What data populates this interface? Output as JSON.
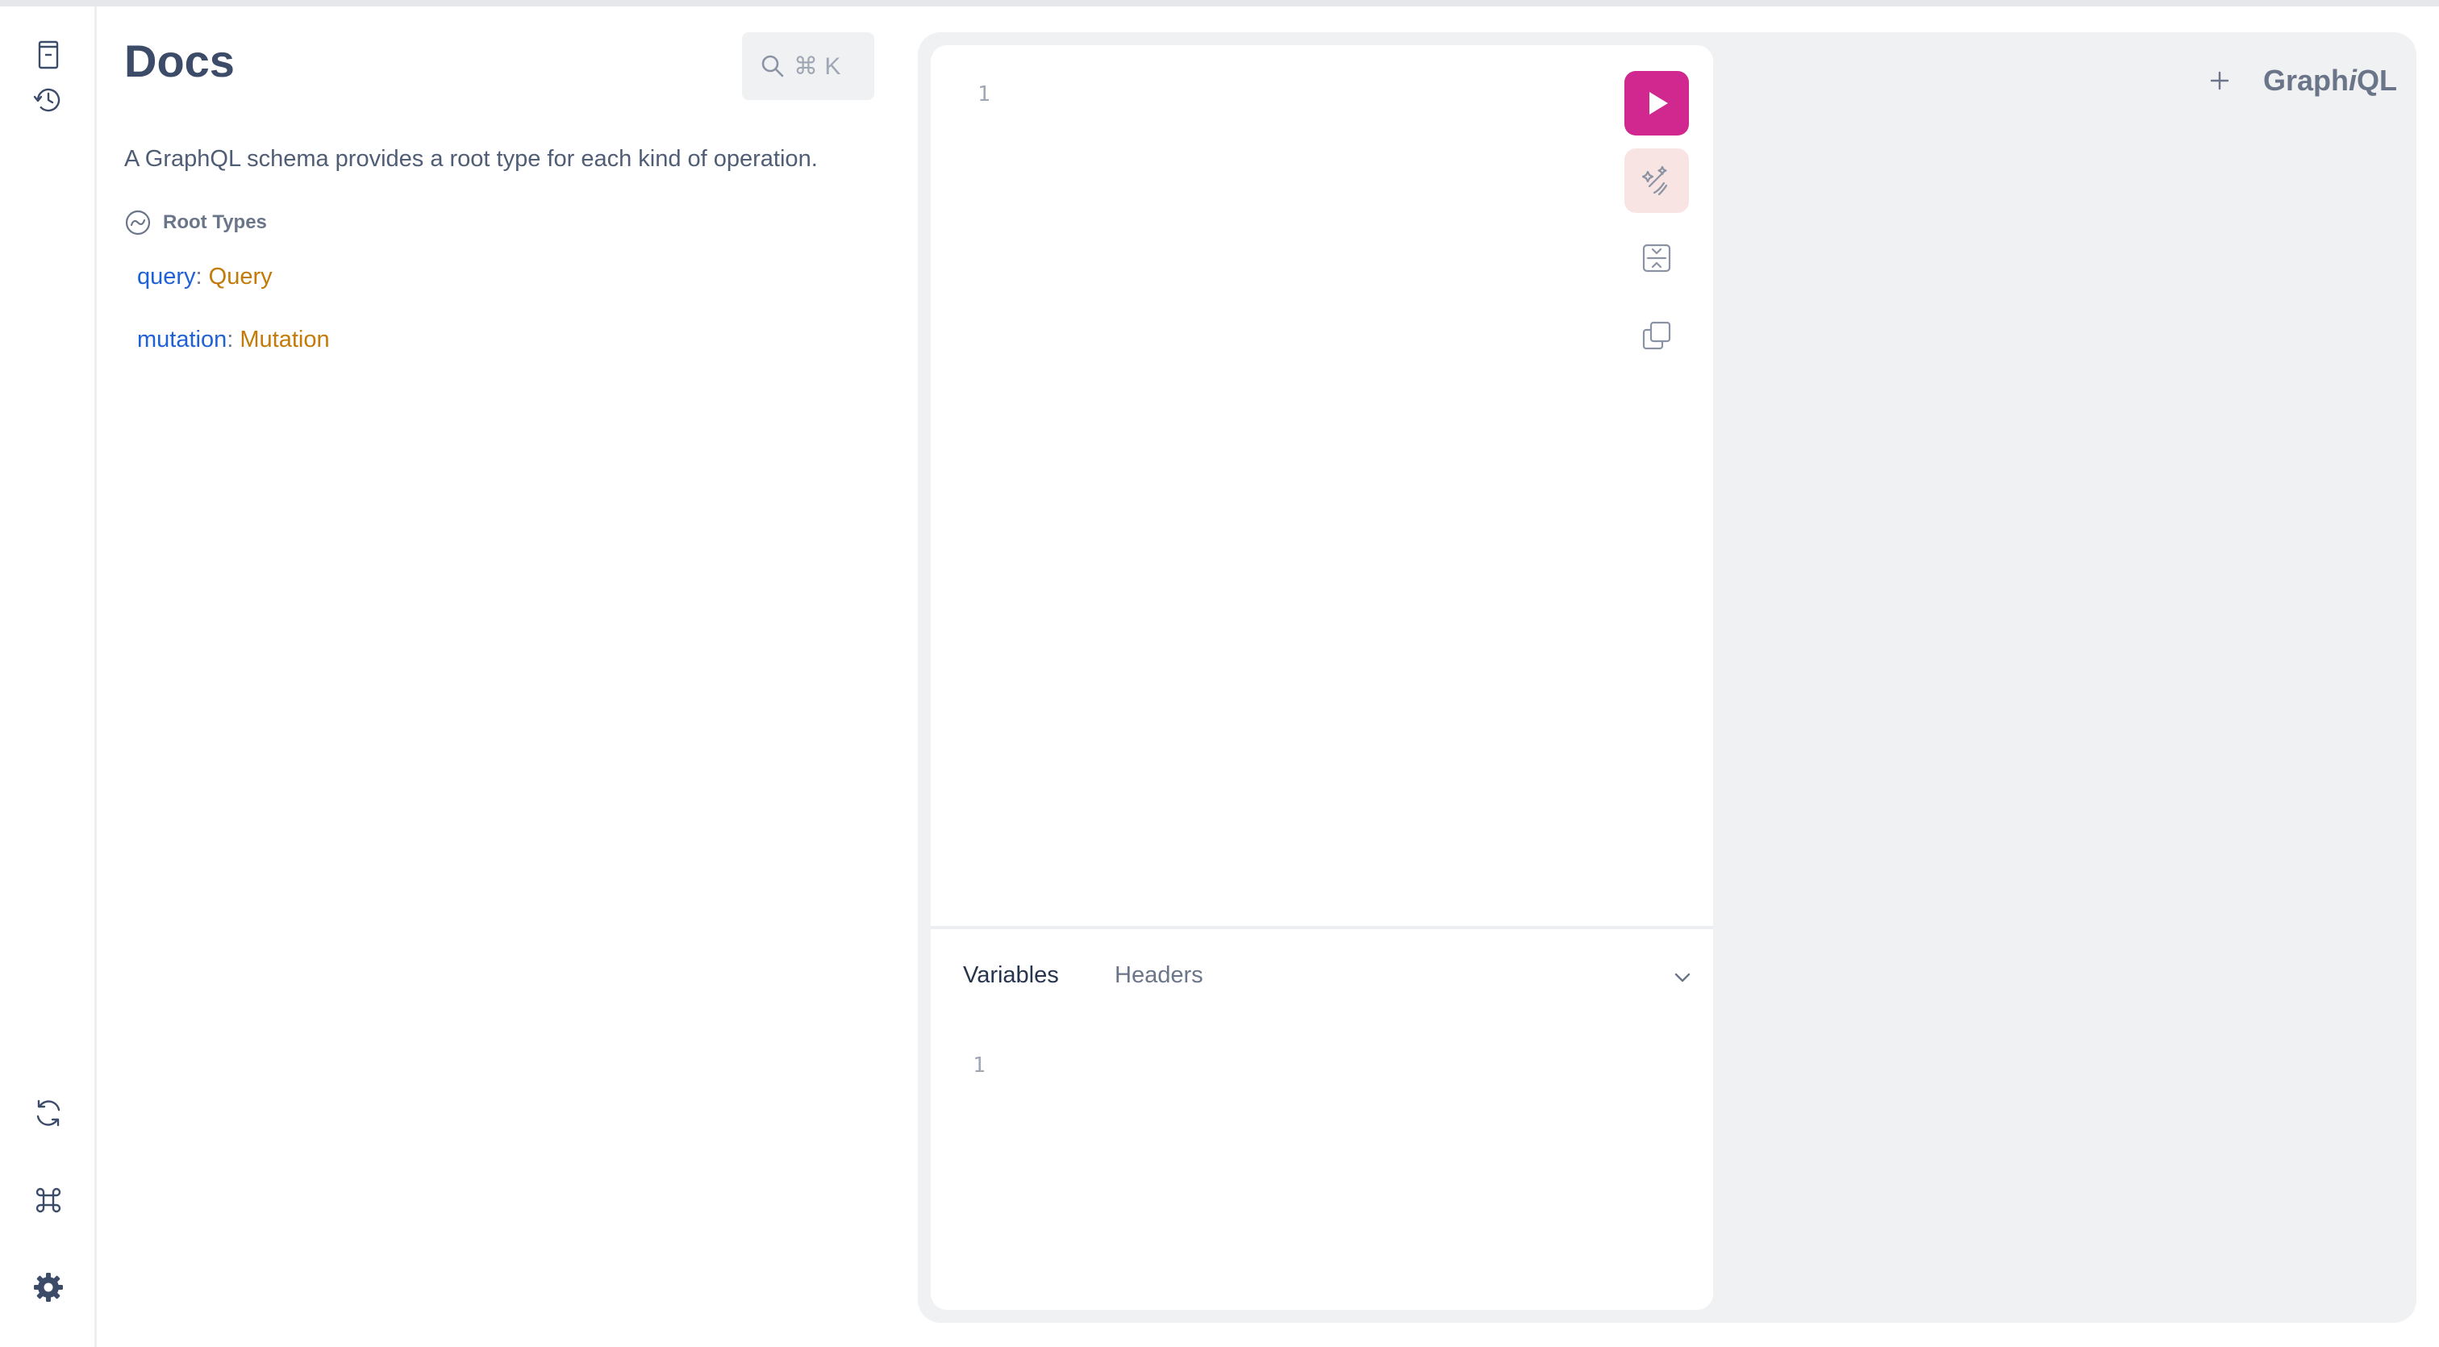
{
  "docs": {
    "title": "Docs",
    "search_shortcut": "⌘ K",
    "description": "A GraphQL schema provides a root type for each kind of operation.",
    "root_types_heading": "Root Types",
    "root_types": [
      {
        "field": "query",
        "type": "Query"
      },
      {
        "field": "mutation",
        "type": "Mutation"
      }
    ]
  },
  "editor": {
    "query_line_number": "1",
    "variables_line_number": "1",
    "tabs": {
      "variables": "Variables",
      "headers": "Headers"
    }
  },
  "brand": {
    "prefix": "Graph",
    "italic": "i",
    "suffix": "QL"
  },
  "colors": {
    "run_button": "#d0288f",
    "prettify_bg": "#f8e4e2",
    "field_link": "#1f61d6",
    "type_link": "#c47a08"
  },
  "icons": {
    "sidebar_top": [
      "docs-icon",
      "history-icon"
    ],
    "sidebar_bottom": [
      "refetch-icon",
      "shortcuts-icon",
      "settings-icon"
    ],
    "toolbar": [
      "play-icon",
      "prettify-icon",
      "merge-icon",
      "copy-icon"
    ]
  }
}
